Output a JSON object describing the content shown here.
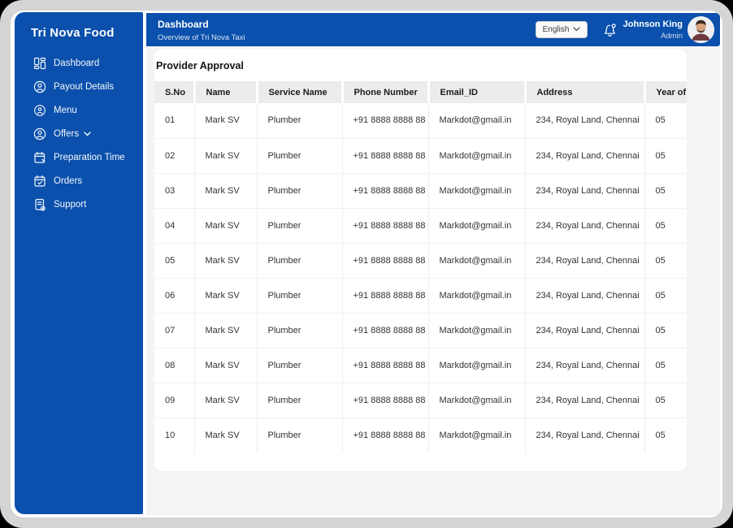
{
  "app": {
    "title": "Tri Nova Food"
  },
  "sidebar": {
    "items": [
      {
        "id": "dashboard",
        "label": "Dashboard",
        "icon": "dashboard-grid-icon",
        "has_chevron": false
      },
      {
        "id": "payout-details",
        "label": "Payout Details",
        "icon": "payout-person-icon",
        "has_chevron": false
      },
      {
        "id": "menu",
        "label": "Menu",
        "icon": "menu-badge-icon",
        "has_chevron": false
      },
      {
        "id": "offers",
        "label": "Offers",
        "icon": "offers-person-icon",
        "has_chevron": true
      },
      {
        "id": "preparation-time",
        "label": "Preparation Time",
        "icon": "calendar-edit-icon",
        "has_chevron": false
      },
      {
        "id": "orders",
        "label": "Orders",
        "icon": "calendar-check-icon",
        "has_chevron": false
      },
      {
        "id": "support",
        "label": "Support",
        "icon": "support-document-icon",
        "has_chevron": false
      }
    ]
  },
  "header": {
    "title": "Dashboard",
    "subtitle": "Overview of Tri Nova Taxi",
    "language_selector": {
      "value": "English",
      "chevron_icon": "chevron-down-icon"
    },
    "notification_icon": "bell-icon",
    "user": {
      "name": "Johnson King",
      "role": "Admin",
      "avatar_icon": "user-avatar-photo"
    }
  },
  "main": {
    "section_title": "Provider Approval",
    "table": {
      "columns": [
        "S.No",
        "Name",
        "Service Name",
        "Phone Number",
        "Email_ID",
        "Address",
        "Year of"
      ],
      "rows": [
        [
          "01",
          "Mark SV",
          "Plumber",
          "+91 8888 8888 88",
          "Markdot@gmail.in",
          "234, Royal Land, Chennai",
          "05"
        ],
        [
          "02",
          "Mark SV",
          "Plumber",
          "+91 8888 8888 88",
          "Markdot@gmail.in",
          "234, Royal Land, Chennai",
          "05"
        ],
        [
          "03",
          "Mark SV",
          "Plumber",
          "+91 8888 8888 88",
          "Markdot@gmail.in",
          "234, Royal Land, Chennai",
          "05"
        ],
        [
          "04",
          "Mark SV",
          "Plumber",
          "+91 8888 8888 88",
          "Markdot@gmail.in",
          "234, Royal Land, Chennai",
          "05"
        ],
        [
          "05",
          "Mark SV",
          "Plumber",
          "+91 8888 8888 88",
          "Markdot@gmail.in",
          "234, Royal Land, Chennai",
          "05"
        ],
        [
          "06",
          "Mark SV",
          "Plumber",
          "+91 8888 8888 88",
          "Markdot@gmail.in",
          "234, Royal Land, Chennai",
          "05"
        ],
        [
          "07",
          "Mark SV",
          "Plumber",
          "+91 8888 8888 88",
          "Markdot@gmail.in",
          "234, Royal Land, Chennai",
          "05"
        ],
        [
          "08",
          "Mark SV",
          "Plumber",
          "+91 8888 8888 88",
          "Markdot@gmail.in",
          "234, Royal Land, Chennai",
          "05"
        ],
        [
          "09",
          "Mark SV",
          "Plumber",
          "+91 8888 8888 88",
          "Markdot@gmail.in",
          "234, Royal Land, Chennai",
          "05"
        ],
        [
          "10",
          "Mark SV",
          "Plumber",
          "+91 8888 8888 88",
          "Markdot@gmail.in",
          "234, Royal Land, Chennai",
          "05"
        ]
      ]
    }
  },
  "colors": {
    "primary_blue": "#0a50ac",
    "frame_gray": "#d5d5d5",
    "main_background": "#f4f4f5",
    "table_header_background": "#ececec"
  }
}
